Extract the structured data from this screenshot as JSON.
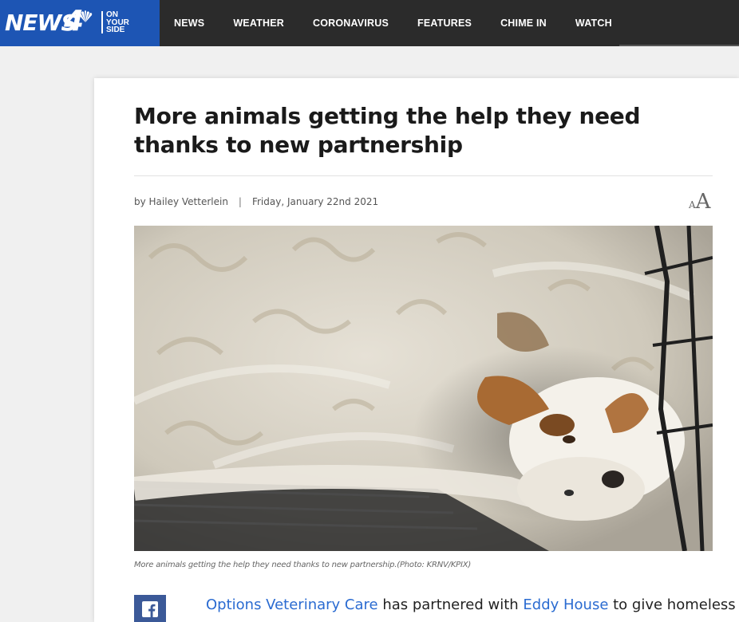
{
  "brand": {
    "name": "NEWS",
    "number": "4",
    "tagline_1": "ON",
    "tagline_2": "YOUR",
    "tagline_3": "SIDE",
    "color": "#1d55b4"
  },
  "nav": {
    "items": [
      "NEWS",
      "WEATHER",
      "CORONAVIRUS",
      "FEATURES",
      "CHIME IN",
      "WATCH"
    ]
  },
  "article": {
    "headline": "More animals getting the help they need thanks to new partnership",
    "byline": "by Hailey Vetterlein",
    "separator": "|",
    "date": "Friday, January 22nd 2021",
    "resize_small": "A",
    "resize_large": "A",
    "caption": "More animals getting the help they need thanks to new partnership.(Photo: KRNV/KPIX)",
    "body": {
      "link_1": "Options Veterinary Care",
      "text_1": " has partnered with ",
      "link_2": "Eddy House",
      "text_2": " to give homeless"
    }
  },
  "share": {
    "facebook_icon": "facebook-icon",
    "facebook_color": "#3b5998"
  },
  "colors": {
    "topbar": "#2b2b2b",
    "link": "#2a6bd1"
  }
}
